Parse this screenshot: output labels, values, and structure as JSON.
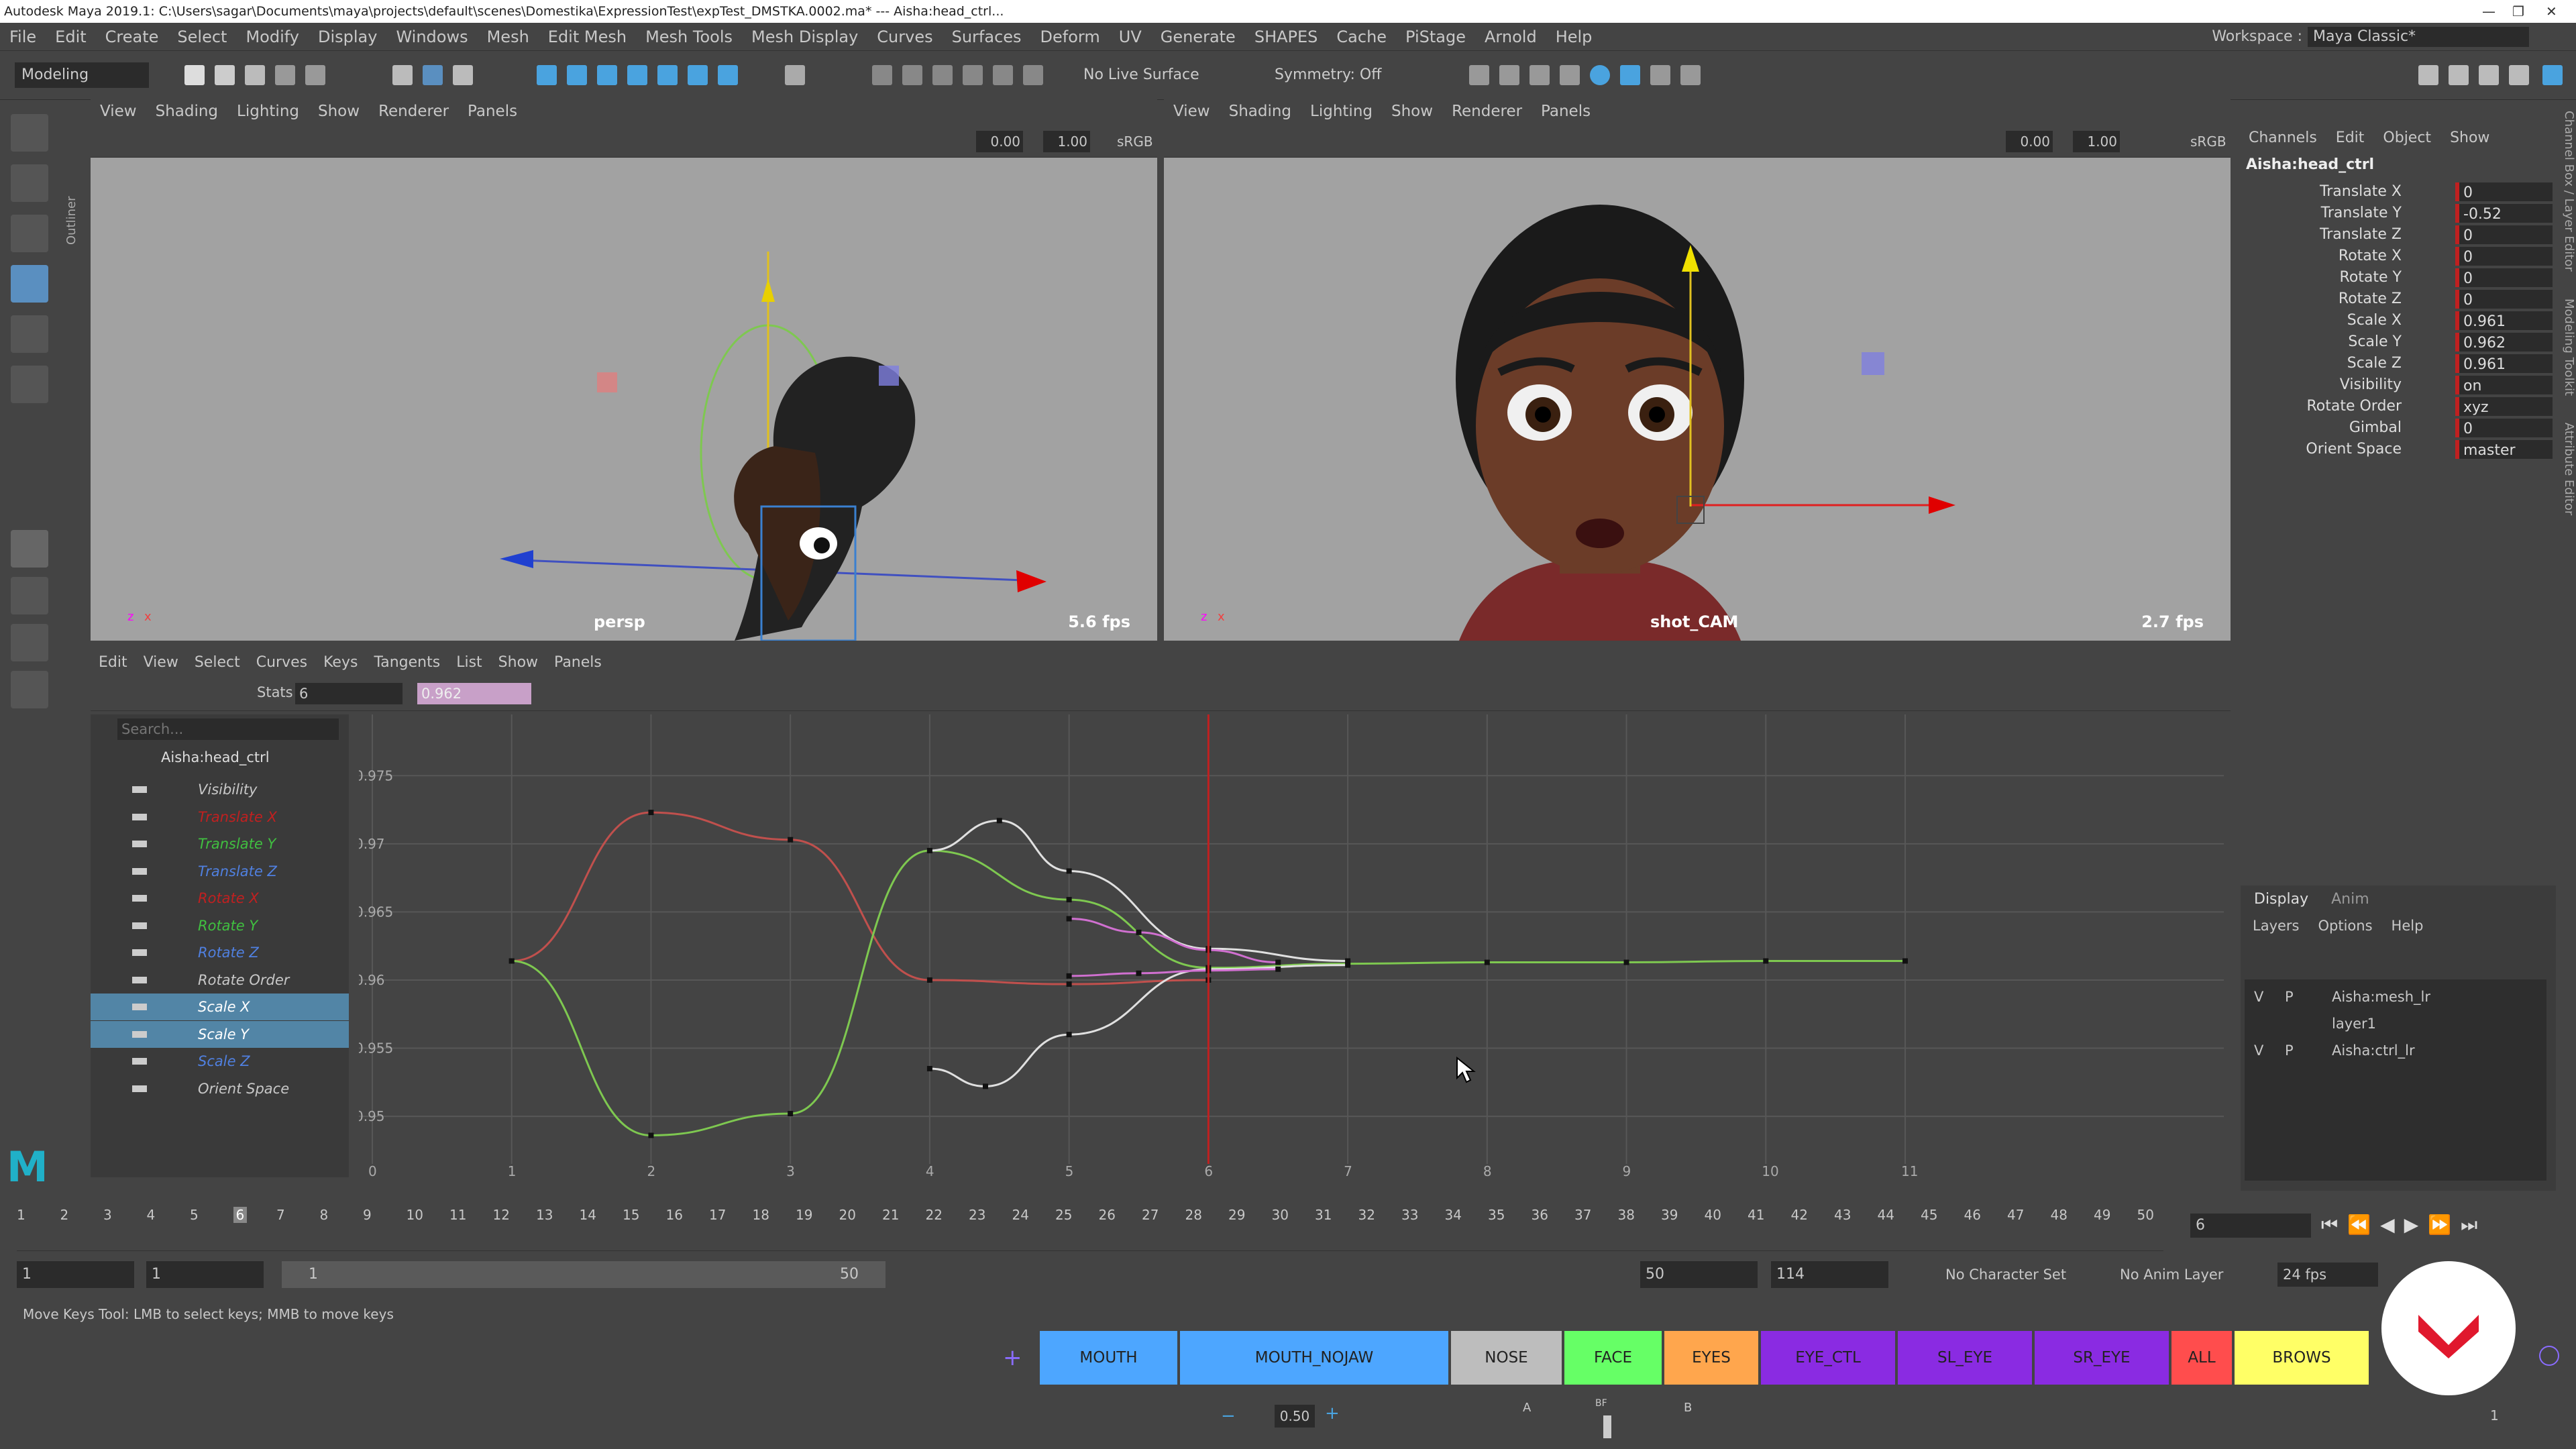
{
  "window": {
    "title": "Autodesk Maya 2019.1: C:\\Users\\sagar\\Documents\\maya\\projects\\default\\scenes\\Domestika\\ExpressionTest\\expTest_DMSTKA.0002.ma*   ---   Aisha:head_ctrl...",
    "controls": [
      "—",
      "❐",
      "✕"
    ]
  },
  "menubar": {
    "items": [
      "File",
      "Edit",
      "Create",
      "Select",
      "Modify",
      "Display",
      "Windows",
      "Mesh",
      "Edit Mesh",
      "Mesh Tools",
      "Mesh Display",
      "Curves",
      "Surfaces",
      "Deform",
      "UV",
      "Generate",
      "SHAPES",
      "Cache",
      "PiStage",
      "Arnold",
      "Help"
    ],
    "workspace_label": "Workspace :",
    "workspace_value": "Maya Classic*"
  },
  "shelf": {
    "mode": "Modeling",
    "live_surface": "No Live Surface",
    "symmetry": "Symmetry: Off"
  },
  "outliner_tab": "Outliner",
  "viewport_left": {
    "menu": [
      "View",
      "Shading",
      "Lighting",
      "Show",
      "Renderer",
      "Panels"
    ],
    "field1": "0.00",
    "field2": "1.00",
    "colorspace": "sRGB",
    "camera": "persp",
    "fps": "5.6 fps"
  },
  "viewport_right": {
    "menu": [
      "View",
      "Shading",
      "Lighting",
      "Show",
      "Renderer",
      "Panels"
    ],
    "field1": "0.00",
    "field2": "1.00",
    "colorspace": "sRGB",
    "camera": "shot_CAM",
    "fps": "2.7 fps"
  },
  "channel_box": {
    "menu": [
      "Channels",
      "Edit",
      "Object",
      "Show"
    ],
    "object": "Aisha:head_ctrl",
    "rows": [
      {
        "name": "Translate X",
        "value": "0"
      },
      {
        "name": "Translate Y",
        "value": "-0.52"
      },
      {
        "name": "Translate Z",
        "value": "0"
      },
      {
        "name": "Rotate X",
        "value": "0"
      },
      {
        "name": "Rotate Y",
        "value": "0"
      },
      {
        "name": "Rotate Z",
        "value": "0"
      },
      {
        "name": "Scale X",
        "value": "0.961"
      },
      {
        "name": "Scale Y",
        "value": "0.962"
      },
      {
        "name": "Scale Z",
        "value": "0.961"
      },
      {
        "name": "Visibility",
        "value": "on"
      },
      {
        "name": "Rotate Order",
        "value": "xyz"
      },
      {
        "name": "Gimbal",
        "value": "0"
      },
      {
        "name": "Orient Space",
        "value": "master"
      }
    ],
    "side_tabs": [
      "Channel Box / Layer Editor",
      "Modeling Toolkit",
      "Attribute Editor"
    ]
  },
  "layer_editor": {
    "tabs": [
      "Display",
      "Anim"
    ],
    "menu": [
      "Layers",
      "Options",
      "Help"
    ],
    "layers": [
      {
        "v": "V",
        "p": "P",
        "name": "Aisha:mesh_lr"
      },
      {
        "v": "",
        "p": "",
        "name": "layer1"
      },
      {
        "v": "V",
        "p": "P",
        "name": "Aisha:ctrl_lr"
      }
    ]
  },
  "graph_editor": {
    "menu": [
      "Edit",
      "View",
      "Select",
      "Curves",
      "Keys",
      "Tangents",
      "List",
      "Show",
      "Panels"
    ],
    "stats_label": "Stats",
    "stats_value": "6",
    "value_field": "0.962",
    "search_placeholder": "Search...",
    "outliner_root": "Aisha:head_ctrl",
    "channels": [
      {
        "name": "Visibility",
        "color": "#c8c8c8",
        "selected": false
      },
      {
        "name": "Translate X",
        "color": "#c02020",
        "selected": false
      },
      {
        "name": "Translate Y",
        "color": "#40c040",
        "selected": false
      },
      {
        "name": "Translate Z",
        "color": "#5080e0",
        "selected": false
      },
      {
        "name": "Rotate X",
        "color": "#c02020",
        "selected": false
      },
      {
        "name": "Rotate Y",
        "color": "#40c040",
        "selected": false
      },
      {
        "name": "Rotate Z",
        "color": "#5080e0",
        "selected": false
      },
      {
        "name": "Rotate Order",
        "color": "#c8c8c8",
        "selected": false
      },
      {
        "name": "Scale X",
        "color": "#ffffff",
        "selected": true
      },
      {
        "name": "Scale Y",
        "color": "#ffffff",
        "selected": true
      },
      {
        "name": "Scale Z",
        "color": "#5080e0",
        "selected": false
      },
      {
        "name": "Orient Space",
        "color": "#c8c8c8",
        "selected": false
      }
    ]
  },
  "chart_data": {
    "type": "line",
    "xlim": [
      0,
      11
    ],
    "ylim": [
      0.947,
      0.979
    ],
    "x_ticks": [
      0,
      1,
      2,
      3,
      4,
      5,
      6,
      7,
      8,
      9,
      10,
      11
    ],
    "y_ticks": [
      "0.95",
      "0.955",
      "0.96",
      "0.965",
      "0.97",
      "0.975"
    ],
    "current_frame": 6,
    "series": [
      {
        "color": "#c0504d",
        "points": [
          [
            1,
            0.9614
          ],
          [
            2,
            0.9723
          ],
          [
            3,
            0.9703
          ],
          [
            4,
            0.96
          ],
          [
            5,
            0.9597
          ],
          [
            6,
            0.96
          ]
        ]
      },
      {
        "color": "#7ec850",
        "points": [
          [
            1,
            0.9614
          ],
          [
            2,
            0.9486
          ],
          [
            3,
            0.9502
          ],
          [
            4,
            0.9695
          ],
          [
            5,
            0.9659
          ],
          [
            6,
            0.9609
          ],
          [
            7,
            0.9612
          ],
          [
            8,
            0.9613
          ],
          [
            9,
            0.9613
          ],
          [
            10,
            0.9614
          ],
          [
            11,
            0.9614
          ]
        ]
      },
      {
        "color": "#e0e0e0",
        "points": [
          [
            4,
            0.9695
          ],
          [
            4.5,
            0.9717
          ],
          [
            5,
            0.968
          ],
          [
            6,
            0.9623
          ],
          [
            7,
            0.9614
          ]
        ]
      },
      {
        "color": "#e0e0e0",
        "points": [
          [
            4,
            0.9535
          ],
          [
            4.4,
            0.9522
          ],
          [
            5,
            0.956
          ],
          [
            6,
            0.9608
          ],
          [
            7,
            0.9611
          ]
        ]
      },
      {
        "color": "#d070d0",
        "points": [
          [
            5,
            0.9645
          ],
          [
            5.5,
            0.9635
          ],
          [
            6,
            0.9622
          ],
          [
            6.5,
            0.9613
          ]
        ]
      },
      {
        "color": "#d070d0",
        "points": [
          [
            5,
            0.9603
          ],
          [
            5.5,
            0.9605
          ],
          [
            6,
            0.9607
          ],
          [
            6.5,
            0.9608
          ]
        ]
      }
    ]
  },
  "timeline": {
    "ticks": [
      "1",
      "2",
      "3",
      "4",
      "5",
      "6",
      "7",
      "8",
      "9",
      "10",
      "11",
      "12",
      "13",
      "14",
      "15",
      "16",
      "17",
      "18",
      "19",
      "20",
      "21",
      "22",
      "23",
      "24",
      "25",
      "26",
      "27",
      "28",
      "29",
      "30",
      "31",
      "32",
      "33",
      "34",
      "35",
      "36",
      "37",
      "38",
      "39",
      "40",
      "41",
      "42",
      "43",
      "44",
      "45",
      "46",
      "47",
      "48",
      "49",
      "50"
    ],
    "current": "6",
    "current_field": "6"
  },
  "range": {
    "start": "1",
    "start2": "1",
    "slider_start": "1",
    "slider_end": "50",
    "end": "50",
    "end2": "114",
    "character_set": "No Character Set",
    "anim_layer": "No Anim Layer",
    "fps": "24 fps"
  },
  "status": "Move Keys Tool: LMB to select keys; MMB to move keys",
  "selection_sets": [
    {
      "label": "MOUTH",
      "color": "#4da6ff"
    },
    {
      "label": "MOUTH_NOJAW",
      "color": "#4da6ff"
    },
    {
      "label": "NOSE",
      "color": "#bdbdbd"
    },
    {
      "label": "FACE",
      "color": "#66ff66"
    },
    {
      "label": "EYES",
      "color": "#ffa64d"
    },
    {
      "label": "EYE_CTL",
      "color": "#8a2be2"
    },
    {
      "label": "SL_EYE",
      "color": "#8a2be2"
    },
    {
      "label": "SR_EYE",
      "color": "#8a2be2"
    },
    {
      "label": "ALL",
      "color": "#ff4d4d"
    },
    {
      "label": "BROWS",
      "color": "#ffff66"
    }
  ],
  "bottom": {
    "value": "0.50",
    "a_label": "A",
    "b_label": "B",
    "bf_label": "BF",
    "page": "1"
  }
}
